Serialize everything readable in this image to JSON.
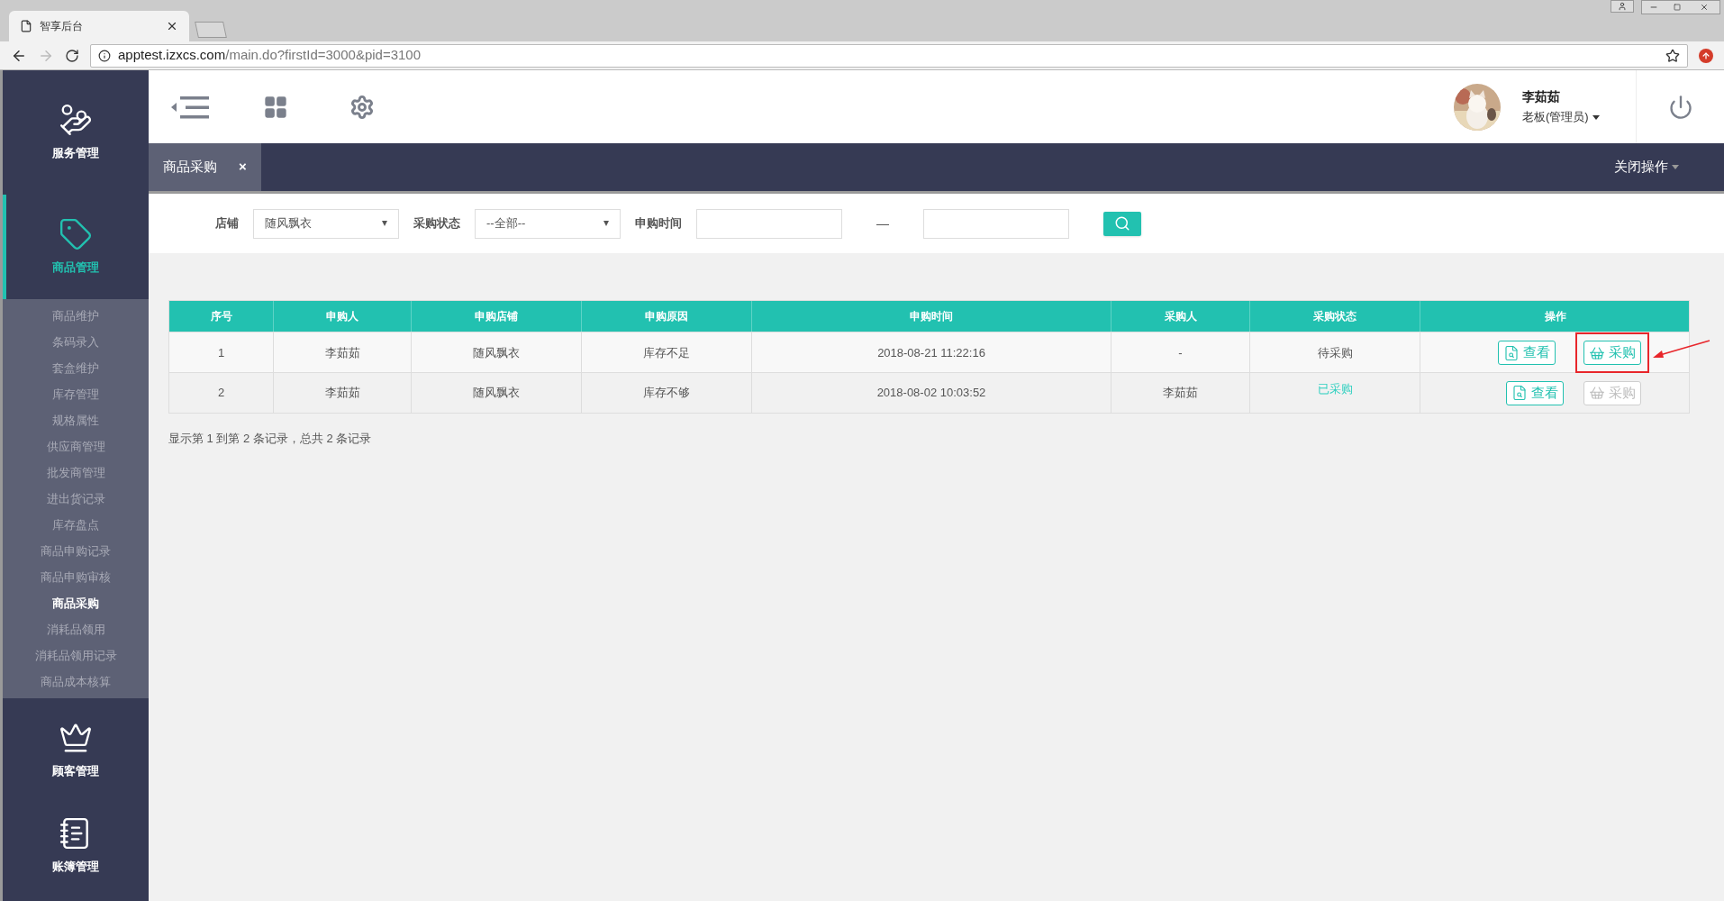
{
  "browser": {
    "tab_title": "智享后台",
    "url_host": "apptest.izxcs.com",
    "url_path": "/main.do?firstId=3000&pid=3100"
  },
  "sidebar": {
    "sections": [
      {
        "label": "服务管理",
        "selected": false
      },
      {
        "label": "商品管理",
        "selected": true,
        "expanded": true,
        "children": [
          {
            "label": "商品维护",
            "selected": false
          },
          {
            "label": "条码录入",
            "selected": false
          },
          {
            "label": "套盒维护",
            "selected": false
          },
          {
            "label": "库存管理",
            "selected": false
          },
          {
            "label": "规格属性",
            "selected": false
          },
          {
            "label": "供应商管理",
            "selected": false
          },
          {
            "label": "批发商管理",
            "selected": false
          },
          {
            "label": "进出货记录",
            "selected": false
          },
          {
            "label": "库存盘点",
            "selected": false
          },
          {
            "label": "商品申购记录",
            "selected": false
          },
          {
            "label": "商品申购审核",
            "selected": false
          },
          {
            "label": "商品采购",
            "selected": true
          },
          {
            "label": "消耗品领用",
            "selected": false
          },
          {
            "label": "消耗品领用记录",
            "selected": false
          },
          {
            "label": "商品成本核算",
            "selected": false
          }
        ]
      },
      {
        "label": "顾客管理",
        "selected": false
      },
      {
        "label": "账簿管理",
        "selected": false
      }
    ]
  },
  "header": {
    "user": {
      "name": "李茹茹",
      "role": "老板(管理员)"
    }
  },
  "tabs": [
    {
      "label": "商品采购",
      "selected": true,
      "close": "×"
    }
  ],
  "close_ops": "关闭操作",
  "filters": [
    {
      "kind": "select",
      "label": "店铺",
      "value": "随风飘衣"
    },
    {
      "kind": "select",
      "label": "采购状态",
      "value": "--全部--"
    },
    {
      "kind": "range",
      "label": "申购时间",
      "separator": "—"
    }
  ],
  "table": {
    "columns": [
      "序号",
      "申购人",
      "申购店铺",
      "申购原因",
      "申购时间",
      "采购人",
      "采购状态",
      "操作"
    ],
    "rows": [
      {
        "cells": [
          "1",
          "李茹茹",
          "随风飘衣",
          "库存不足",
          "2018-08-21 11:22:16",
          "-"
        ],
        "status": "待采购",
        "purchased": false,
        "actions": [
          {
            "kind": "view",
            "label": "查看",
            "disabled": false,
            "highlighted": false
          },
          {
            "kind": "purchase",
            "label": "采购",
            "disabled": false,
            "highlighted": true
          }
        ]
      },
      {
        "cells": [
          "2",
          "李茹茹",
          "随风飘衣",
          "库存不够",
          "2018-08-02 10:03:52",
          "李茹茹"
        ],
        "status": "已采购",
        "purchased": true,
        "actions": [
          {
            "kind": "view",
            "label": "查看",
            "disabled": false,
            "highlighted": false
          },
          {
            "kind": "purchase",
            "label": "采购",
            "disabled": true,
            "highlighted": false
          }
        ]
      }
    ]
  },
  "footer": "显示第 1 到第 2 条记录，总共 2 条记录"
}
